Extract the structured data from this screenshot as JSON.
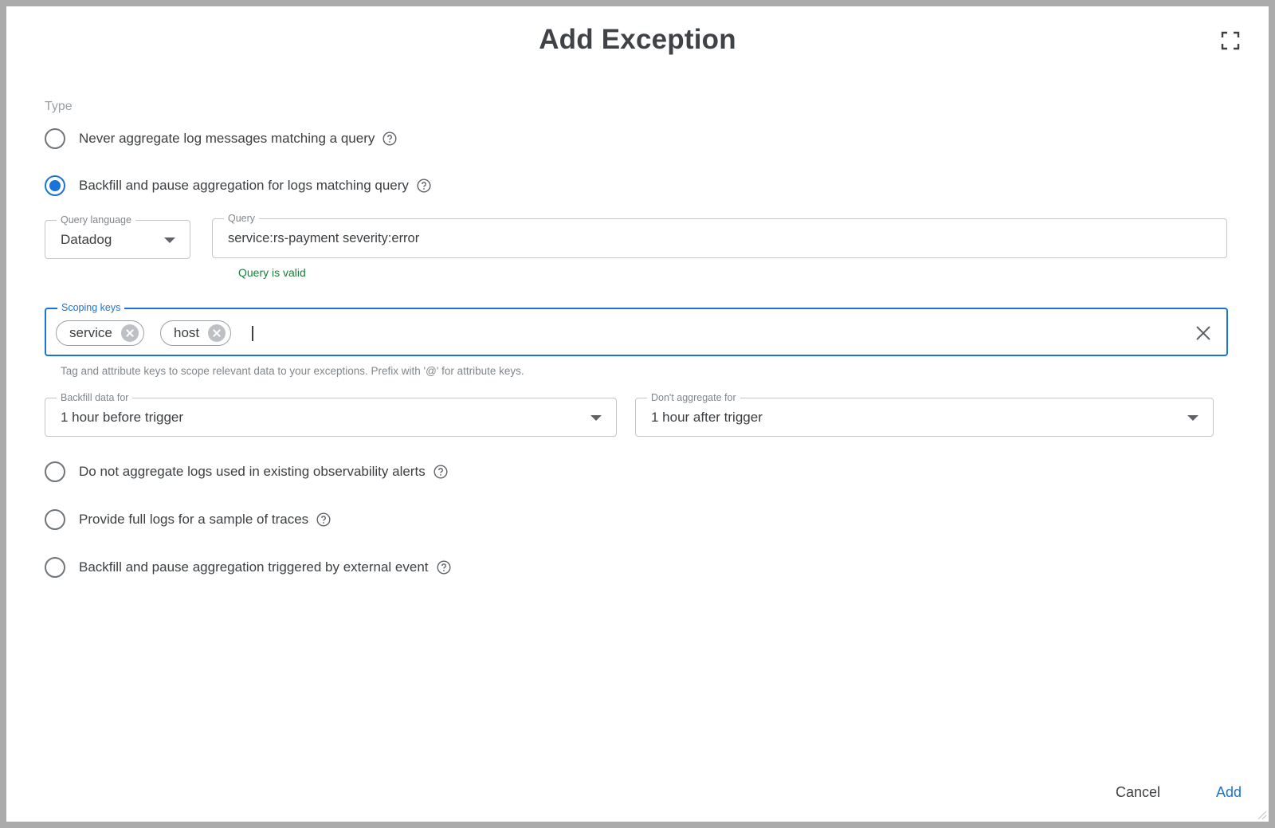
{
  "dialog": {
    "title": "Add Exception",
    "fullscreen_icon": "expand-icon"
  },
  "type_section": {
    "label": "Type",
    "options": [
      {
        "label": "Never aggregate log messages matching a query",
        "selected": false
      },
      {
        "label": "Backfill and pause aggregation for logs matching query",
        "selected": true
      },
      {
        "label": "Do not aggregate logs used in existing observability alerts",
        "selected": false
      },
      {
        "label": "Provide full logs for a sample of traces",
        "selected": false
      },
      {
        "label": "Backfill and pause aggregation triggered by external event",
        "selected": false
      }
    ]
  },
  "query_language": {
    "label": "Query language",
    "value": "Datadog"
  },
  "query": {
    "label": "Query",
    "value": "service:rs-payment severity:error",
    "status": "Query is valid"
  },
  "scoping_keys": {
    "label": "Scoping keys",
    "chips": [
      "service",
      "host"
    ],
    "helper": "Tag and attribute keys to scope relevant data to your exceptions. Prefix with '@' for attribute keys."
  },
  "backfill": {
    "label": "Backfill data for",
    "value": "1 hour before trigger"
  },
  "dont_aggregate": {
    "label": "Don't aggregate for",
    "value": "1 hour after trigger"
  },
  "footer": {
    "cancel_label": "Cancel",
    "add_label": "Add"
  },
  "colors": {
    "accent": "#1a73d8",
    "valid": "#188038",
    "overlay": "#ababab"
  }
}
